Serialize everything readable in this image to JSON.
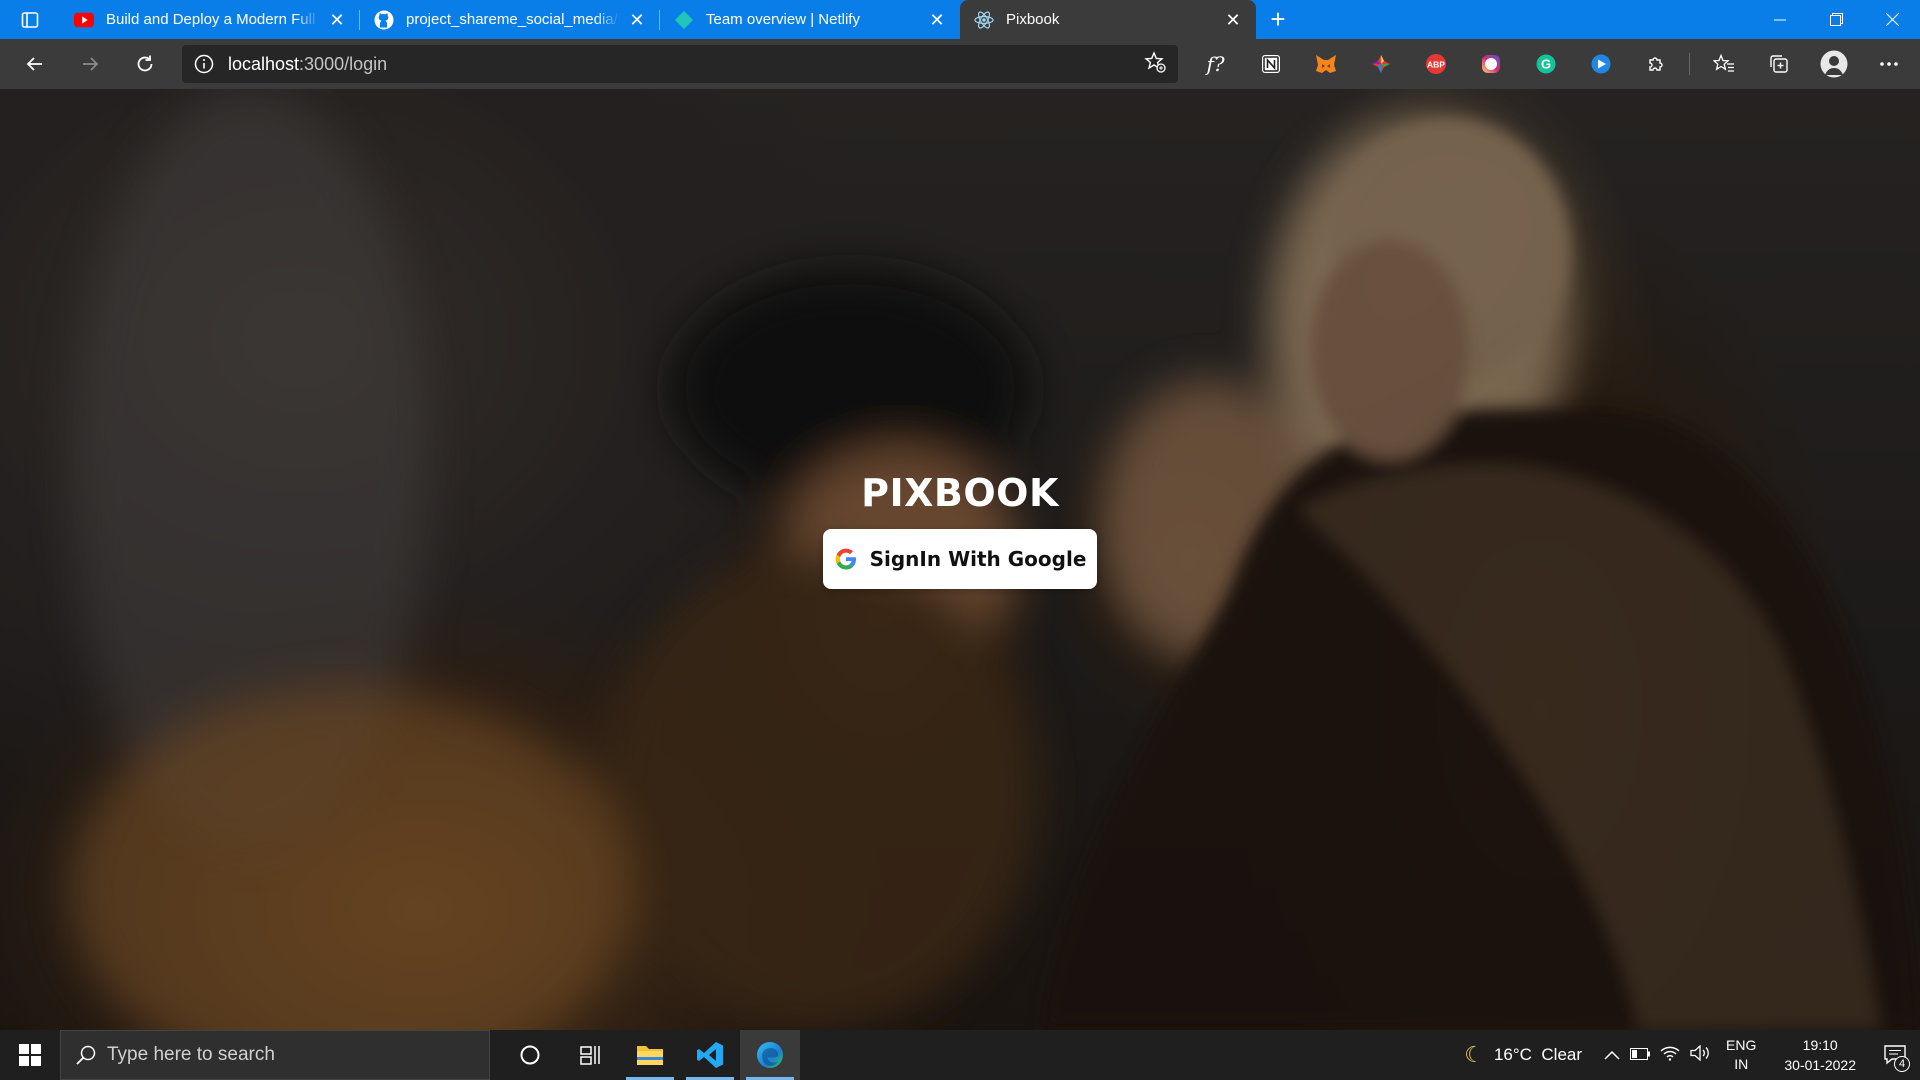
{
  "browser": {
    "tabs": [
      {
        "title": "Build and Deploy a Modern Full",
        "favicon": "youtube-icon",
        "active": false
      },
      {
        "title": "project_shareme_social_media/b",
        "favicon": "github-icon",
        "active": false
      },
      {
        "title": "Team overview | Netlify",
        "favicon": "netlify-icon",
        "active": false
      },
      {
        "title": "Pixbook",
        "favicon": "react-icon",
        "active": true
      }
    ],
    "address": {
      "host": "localhost",
      "path": ":3000/login"
    },
    "extensions": [
      "font-f-icon",
      "notion-icon",
      "metamask-icon",
      "color-picker-icon",
      "adblock-plus-icon",
      "instagram-icon",
      "grammarly-icon",
      "video-icon",
      "extensions-puzzle-icon",
      "favorites-icon",
      "collections-icon",
      "profile-avatar",
      "more-icon"
    ],
    "extension_labels": {
      "adblock": "ABP"
    }
  },
  "page": {
    "logo": "PIXBOOK",
    "signin_label": "SignIn With Google"
  },
  "taskbar": {
    "search_placeholder": "Type here to search",
    "weather": "16°C  Clear",
    "lang_top": "ENG",
    "lang_bottom": "IN",
    "time": "19:10",
    "date": "30-01-2022",
    "notification_count": "4"
  },
  "colors": {
    "tabbar": "#0a7ee8",
    "toolbar": "#3b3b3b",
    "taskbar": "#1f1f1f"
  }
}
